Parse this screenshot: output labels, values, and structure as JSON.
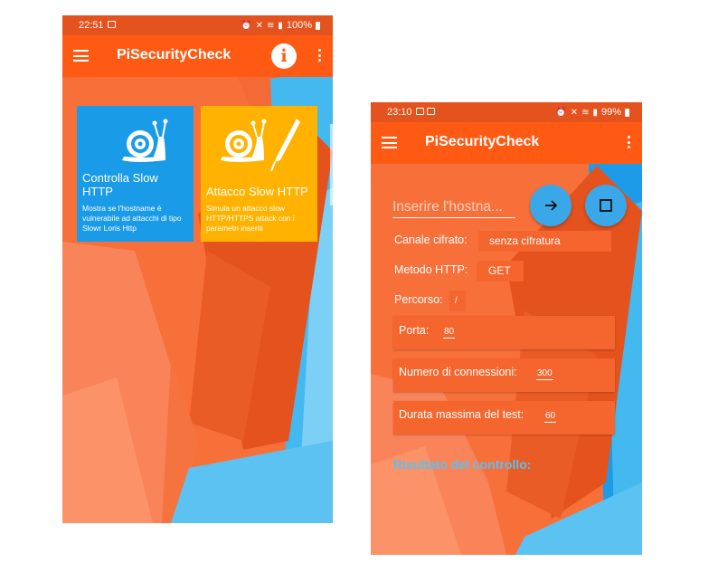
{
  "colors": {
    "status_bar": "#e4521e",
    "app_bar": "#ff5a14",
    "card_blue": "#1a9be8",
    "card_yellow": "#ffb300",
    "result_label": "#5bc0f0"
  },
  "screen1": {
    "status": {
      "time": "22:51",
      "battery": "100%"
    },
    "app_title": "PiSecurityCheck",
    "icons": {
      "menu": "menu-icon",
      "info": "info-icon",
      "more": "more-vert-icon",
      "snail": "snail-icon",
      "pen": "pen-icon"
    },
    "cards": [
      {
        "title": "Controlla Slow HTTP",
        "description": "Mostra se l'hostname è vulnerabile ad attacchi di tipo Slowr Loris Http"
      },
      {
        "title": "Attacco Slow HTTP",
        "description": "Simula un attacco slow HTTP/HTTPS attack con i parametri inseriti"
      }
    ]
  },
  "screen2": {
    "status": {
      "time": "23:10",
      "battery": "99%"
    },
    "app_title": "PiSecurityCheck",
    "hostname_placeholder": "Inserire l'hostna...",
    "fab_icons": {
      "go": "arrow-right-icon",
      "stop": "stop-square-icon"
    },
    "fields": {
      "channel": {
        "label": "Canale cifrato:",
        "value": "senza cifratura"
      },
      "method": {
        "label": "Metodo HTTP:",
        "value": "GET"
      },
      "path": {
        "label": "Percorso:",
        "value": "/"
      },
      "port": {
        "label": "Porta:",
        "value": "80"
      },
      "connections": {
        "label": "Numero di connessioni:",
        "value": "300"
      },
      "duration": {
        "label": "Durata massima del test:",
        "value": "60"
      }
    },
    "result_label": "Risultato del controllo:"
  }
}
